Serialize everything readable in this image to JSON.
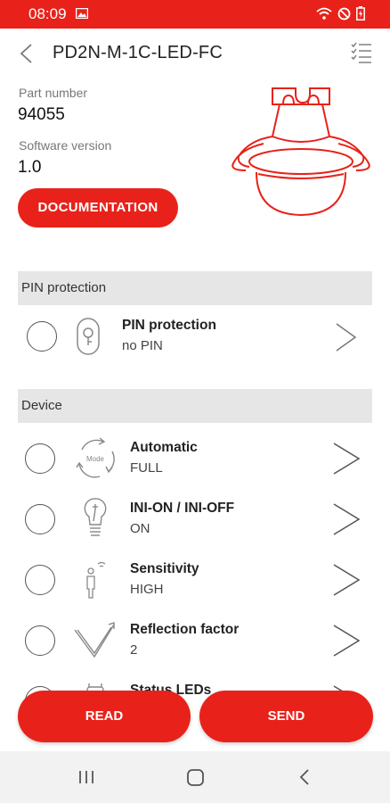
{
  "status_bar": {
    "time": "08:09"
  },
  "toolbar": {
    "title": "PD2N-M-1C-LED-FC"
  },
  "info": {
    "part_number_label": "Part number",
    "part_number_value": "94055",
    "software_version_label": "Software version",
    "software_version_value": "1.0",
    "documentation_label": "DOCUMENTATION"
  },
  "sections": {
    "pin": {
      "header": "PIN protection",
      "item": {
        "title": "PIN protection",
        "value": "no PIN",
        "icon": "lock-icon"
      }
    },
    "device": {
      "header": "Device",
      "items": [
        {
          "title": "Automatic",
          "value": "FULL",
          "icon": "mode-cycle-icon"
        },
        {
          "title": "INI-ON / INI-OFF",
          "value": "ON",
          "icon": "bulb-icon"
        },
        {
          "title": "Sensitivity",
          "value": "HIGH",
          "icon": "person-signal-icon"
        },
        {
          "title": "Reflection factor",
          "value": "2",
          "icon": "reflection-icon"
        },
        {
          "title": "Status LEDs",
          "value": "",
          "icon": "led-icon"
        }
      ]
    }
  },
  "actions": {
    "read_label": "READ",
    "send_label": "SEND"
  },
  "colors": {
    "accent": "#e8221a",
    "section_bg": "#e6e6e6",
    "nav_bg": "#f2f2f2"
  }
}
